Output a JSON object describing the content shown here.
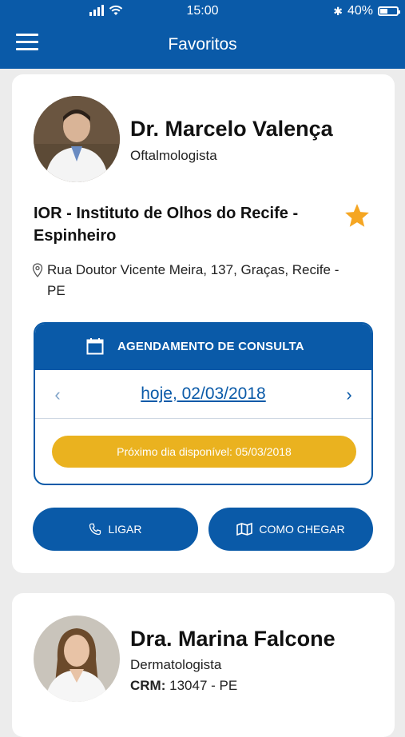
{
  "status_bar": {
    "time": "15:00",
    "battery": "40%",
    "battery_level": 0.4
  },
  "header": {
    "title": "Favoritos"
  },
  "doctors": [
    {
      "name": "Dr. Marcelo Valença",
      "specialty": "Oftalmologista",
      "clinic": "IOR - Instituto de Olhos do Recife - Espinheiro",
      "address": "Rua Doutor Vicente Meira, 137, Graças, Recife - PE",
      "schedule": {
        "title": "AGENDAMENTO DE CONSULTA",
        "date": "hoje, 02/03/2018",
        "next_available": "Próximo dia disponível: 05/03/2018"
      },
      "actions": {
        "call": "LIGAR",
        "directions": "COMO CHEGAR"
      }
    },
    {
      "name": "Dra. Marina Falcone",
      "specialty": "Dermatologista",
      "crm_label": "CRM:",
      "crm_value": "13047 - PE"
    }
  ],
  "colors": {
    "primary": "#0a5aa8",
    "accent_star": "#f5a623",
    "next_available_bg": "#eab21f"
  }
}
